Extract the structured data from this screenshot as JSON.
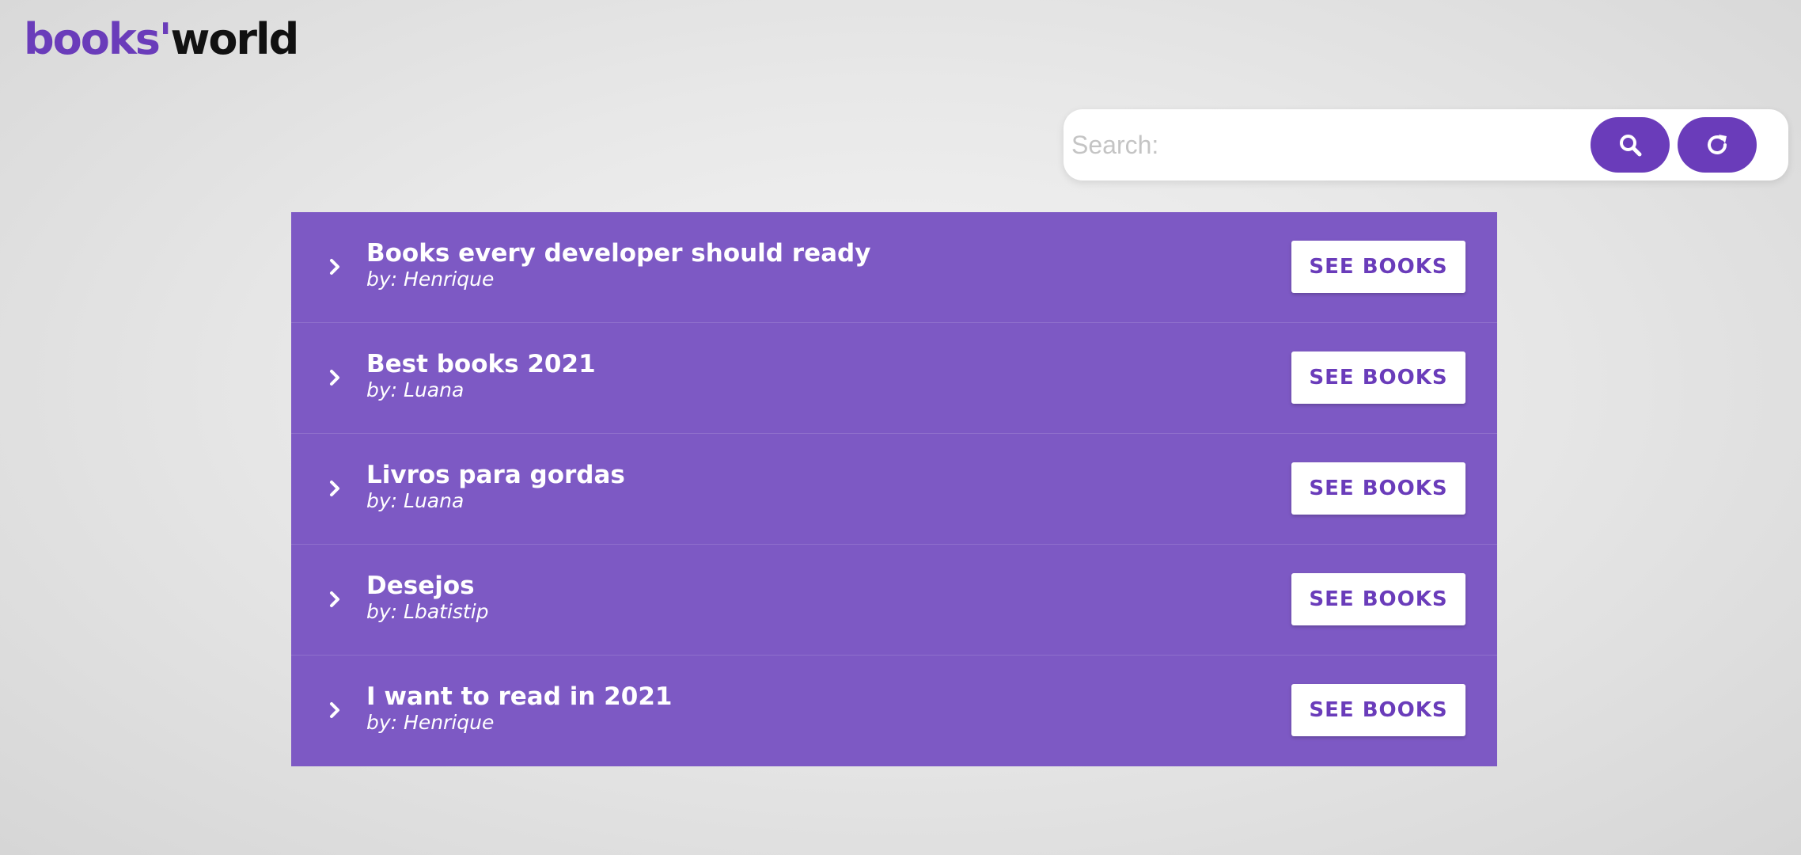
{
  "brand": {
    "part1": "books'",
    "part2": "world",
    "color": "#6a3cba"
  },
  "search": {
    "placeholder": "Search:",
    "value": "",
    "search_icon": "search-icon",
    "refresh_icon": "refresh-icon"
  },
  "colors": {
    "accent": "#6a3cba",
    "list_background": "#7d59c4",
    "text_on_accent": "#ffffff"
  },
  "lists": [
    {
      "title": "Books every developer should ready",
      "author": "by: Henrique",
      "button": "SEE BOOKS"
    },
    {
      "title": "Best books 2021",
      "author": "by: Luana",
      "button": "SEE BOOKS"
    },
    {
      "title": "Livros para gordas",
      "author": "by: Luana",
      "button": "SEE BOOKS"
    },
    {
      "title": "Desejos",
      "author": "by: Lbatistip",
      "button": "SEE BOOKS"
    },
    {
      "title": "I want to read in 2021",
      "author": "by: Henrique",
      "button": "SEE BOOKS"
    }
  ]
}
